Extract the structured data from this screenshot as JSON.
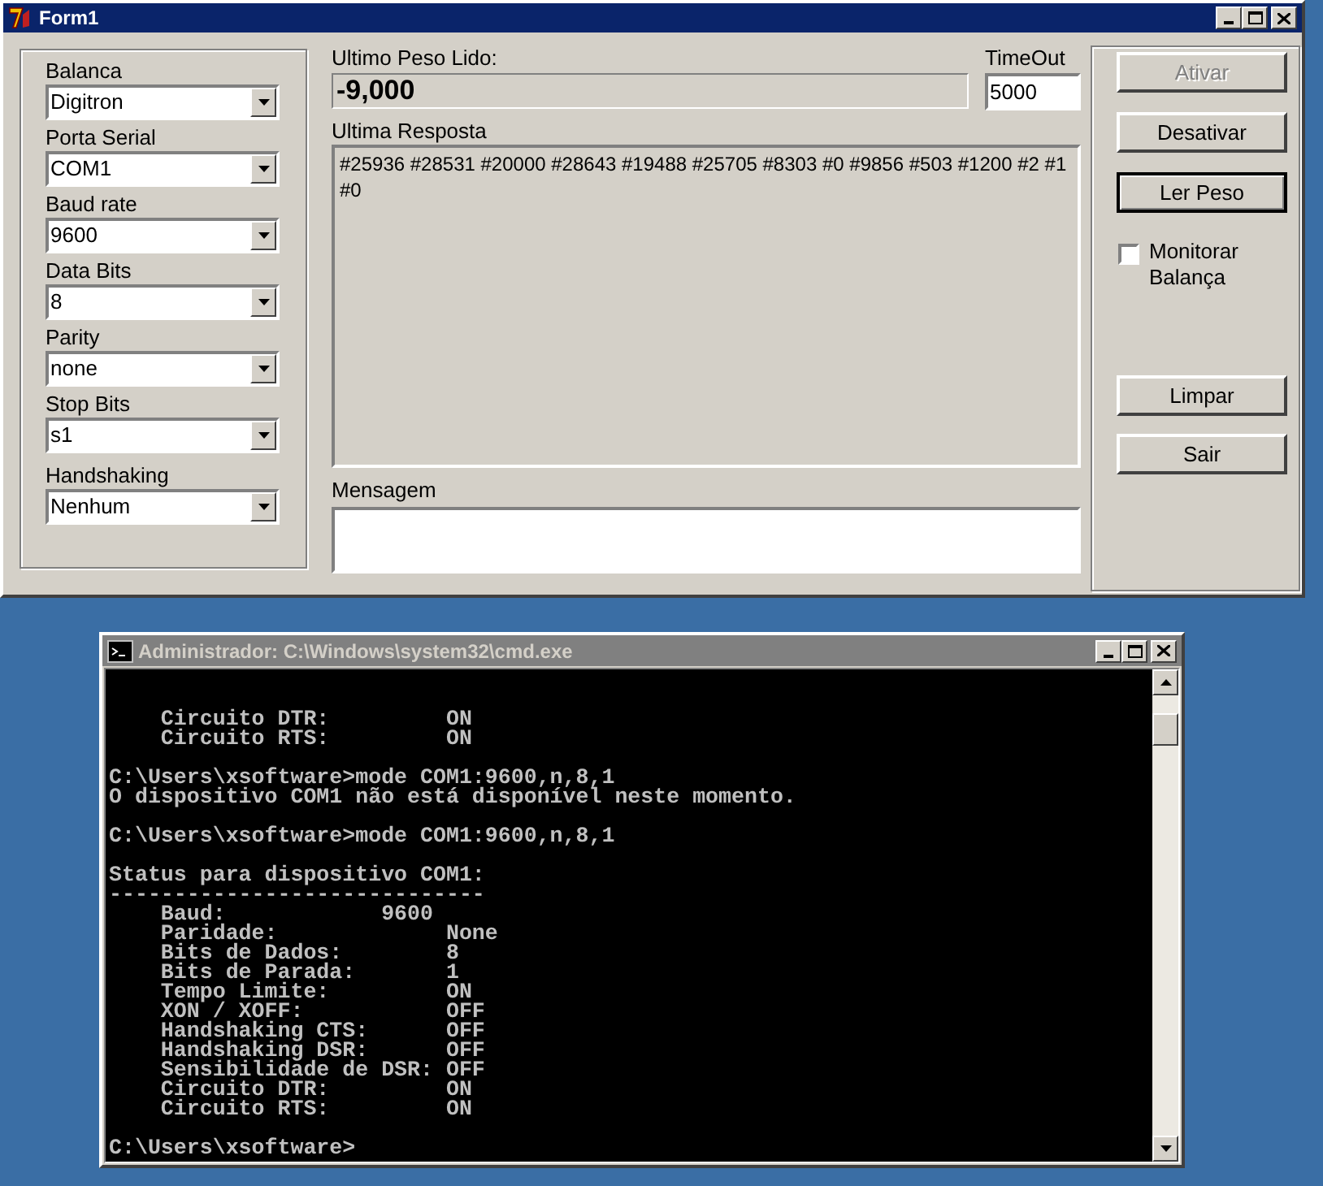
{
  "form_window": {
    "title": "Form1"
  },
  "settings": [
    {
      "label": "Balanca",
      "value": "Digitron"
    },
    {
      "label": "Porta Serial",
      "value": "COM1"
    },
    {
      "label": "Baud rate",
      "value": "9600"
    },
    {
      "label": "Data Bits",
      "value": "8"
    },
    {
      "label": "Parity",
      "value": "none"
    },
    {
      "label": "Stop Bits",
      "value": "s1"
    },
    {
      "label": "Handshaking",
      "value": "Nenhum"
    }
  ],
  "last_weight": {
    "label": "Ultimo Peso Lido:",
    "value": "-9,000"
  },
  "timeout": {
    "label": "TimeOut",
    "value": "5000"
  },
  "last_response": {
    "label": "Ultima Resposta",
    "value": "#25936 #28531 #20000 #28643 #19488 #25705 #8303 #0 #9856 #503 #1200 #2 #1 #0"
  },
  "message": {
    "label": "Mensagem"
  },
  "top_buttons": [
    {
      "label": "Ativar",
      "disabled": true,
      "focused": false
    },
    {
      "label": "Desativar",
      "disabled": false,
      "focused": false
    },
    {
      "label": "Ler Peso",
      "disabled": false,
      "focused": true
    }
  ],
  "monitor_checkbox": {
    "label": "Monitorar Balança",
    "checked": false
  },
  "bottom_buttons": [
    {
      "label": "Limpar",
      "disabled": false,
      "focused": false
    },
    {
      "label": "Sair",
      "disabled": false,
      "focused": false
    }
  ],
  "console_window": {
    "title": "Administrador: C:\\Windows\\system32\\cmd.exe",
    "blocks": [
      {
        "lines": [
          "    Circuito DTR:         ON",
          "    Circuito RTS:         ON"
        ]
      },
      {
        "lines": [
          "C:\\Users\\xsoftware>mode COM1:9600,n,8,1",
          "O dispositivo COM1 não está disponível neste momento."
        ]
      },
      {
        "lines": [
          "C:\\Users\\xsoftware>mode COM1:9600,n,8,1"
        ]
      },
      {
        "lines": [
          "Status para dispositivo COM1:",
          "-----------------------------",
          "    Baud:            9600",
          "    Paridade:             None",
          "    Bits de Dados:        8",
          "    Bits de Parada:       1",
          "    Tempo Limite:         ON",
          "    XON / XOFF:           OFF",
          "    Handshaking CTS:      OFF",
          "    Handshaking DSR:      OFF",
          "    Sensibilidade de DSR: OFF",
          "    Circuito DTR:         ON",
          "    Circuito RTS:         ON"
        ]
      },
      {
        "lines": [
          "C:\\Users\\xsoftware>"
        ]
      }
    ]
  }
}
